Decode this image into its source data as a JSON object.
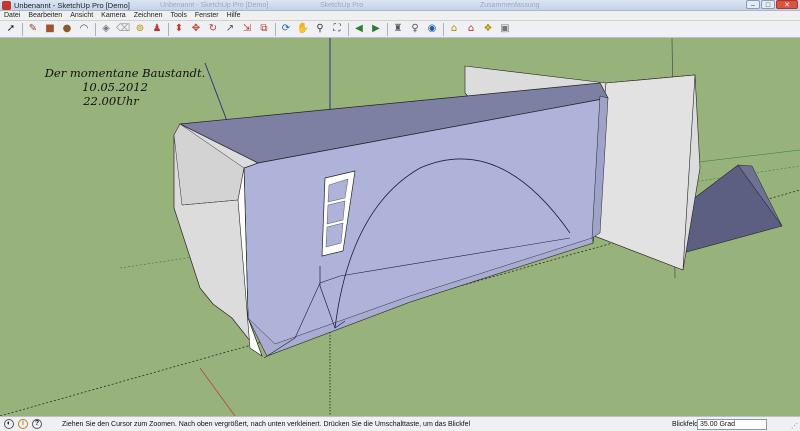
{
  "window": {
    "title": "Unbenannt - SketchUp Pro [Demo]",
    "ghost_labels": [
      "Unbenannt - SketchUp Pro [Demo]",
      "SketchUp Pro",
      "Zusammenfassung"
    ],
    "controls": {
      "minimize": "–",
      "maximize": "□",
      "close": "✕"
    }
  },
  "menu": [
    "Datei",
    "Bearbeiten",
    "Ansicht",
    "Kamera",
    "Zeichnen",
    "Tools",
    "Fenster",
    "Hilfe"
  ],
  "toolbar": {
    "tools": [
      {
        "name": "select-tool-icon",
        "glyph": "➚",
        "color": "#222"
      },
      {
        "name": "separator"
      },
      {
        "name": "pencil-tool-icon",
        "glyph": "✎",
        "color": "#b03a2e"
      },
      {
        "name": "rectangle-tool-icon",
        "glyph": "■",
        "color": "#a0522d"
      },
      {
        "name": "circle-tool-icon",
        "glyph": "●",
        "color": "#8b5a2b"
      },
      {
        "name": "arc-tool-icon",
        "glyph": "◠",
        "color": "#444"
      },
      {
        "name": "separator"
      },
      {
        "name": "make-component-tool-icon",
        "glyph": "◈",
        "color": "#777"
      },
      {
        "name": "eraser-tool-icon",
        "glyph": "⌫",
        "color": "#999"
      },
      {
        "name": "tape-measure-tool-icon",
        "glyph": "⊚",
        "color": "#b8860b"
      },
      {
        "name": "paint-bucket-tool-icon",
        "glyph": "♟",
        "color": "#c0392b"
      },
      {
        "name": "separator"
      },
      {
        "name": "push-pull-tool-icon",
        "glyph": "⬍",
        "color": "#c0392b"
      },
      {
        "name": "move-tool-icon",
        "glyph": "✥",
        "color": "#c0392b"
      },
      {
        "name": "rotate-tool-icon",
        "glyph": "↻",
        "color": "#c0392b"
      },
      {
        "name": "follow-me-tool-icon",
        "glyph": "↗",
        "color": "#555"
      },
      {
        "name": "scale-tool-icon",
        "glyph": "⇲",
        "color": "#c0392b"
      },
      {
        "name": "offset-tool-icon",
        "glyph": "⧉",
        "color": "#c0392b"
      },
      {
        "name": "separator"
      },
      {
        "name": "orbit-tool-icon",
        "glyph": "⟳",
        "color": "#1f5fa8"
      },
      {
        "name": "pan-tool-icon",
        "glyph": "✋",
        "color": "#444"
      },
      {
        "name": "zoom-tool-icon",
        "glyph": "⚲",
        "color": "#333"
      },
      {
        "name": "zoom-extents-tool-icon",
        "glyph": "⛶",
        "color": "#333"
      },
      {
        "name": "separator"
      },
      {
        "name": "previous-view-icon",
        "glyph": "◀",
        "color": "#2e7d32"
      },
      {
        "name": "next-view-icon",
        "glyph": "▶",
        "color": "#2e7d32"
      },
      {
        "name": "separator"
      },
      {
        "name": "position-camera-icon",
        "glyph": "♜",
        "color": "#555"
      },
      {
        "name": "walk-tool-icon",
        "glyph": "♀",
        "color": "#555"
      },
      {
        "name": "look-around-icon",
        "glyph": "◉",
        "color": "#1f5fa8"
      },
      {
        "name": "separator"
      },
      {
        "name": "get-models-icon",
        "glyph": "⌂",
        "color": "#b8860b"
      },
      {
        "name": "share-model-icon",
        "glyph": "⌂",
        "color": "#c0392b"
      },
      {
        "name": "share-component-icon",
        "glyph": "❖",
        "color": "#b8860b"
      },
      {
        "name": "extension-warehouse-icon",
        "glyph": "▣",
        "color": "#777"
      }
    ]
  },
  "viewport": {
    "annotation": [
      "Der momentane Baustandt.",
      "10.05.2012",
      "22.00Uhr"
    ],
    "colors": {
      "ground": "#97b37b",
      "wall_front": "#b0b3d9",
      "roof": "#7d80a3",
      "end_wall": "#dcdcdc"
    }
  },
  "statusbar": {
    "message": "Ziehen Sie den Cursor zum Zoomen.  Nach oben vergrößert, nach unten verkleinert.  Drücken Sie die Umschalttaste, um das Blickfel",
    "vcb_label": "Blickfeld",
    "vcb_value": "35.00 Grad",
    "icons": [
      {
        "name": "geo-location-icon",
        "glyph": "◐"
      },
      {
        "name": "credits-icon",
        "glyph": "i"
      },
      {
        "name": "help-icon",
        "glyph": "?"
      }
    ]
  }
}
